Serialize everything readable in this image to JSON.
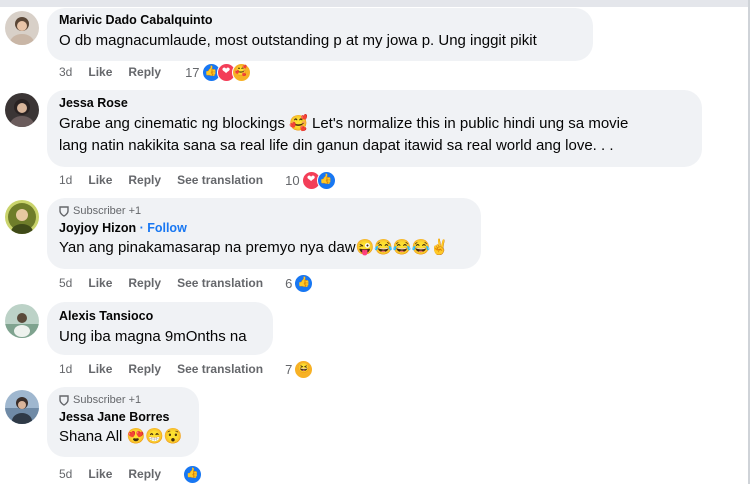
{
  "comments": [
    {
      "name": "Marivic Dado Cabalquinto",
      "text": "O db magnacumlaude, most outstanding p at my jowa p. Ung inggit pikit",
      "age": "3d",
      "like": "Like",
      "reply": "Reply",
      "reaction_count": "17",
      "reactions": [
        "like-icon",
        "love-icon",
        "care-icon"
      ]
    },
    {
      "name": "Jessa Rose",
      "text_line1": "Grabe ang cinematic ng blockings 🥰 Let's normalize this in public hindi ung sa movie",
      "text_line2": "lang natin nakikita sana sa real life din ganun dapat itawid sa real world ang love. . .",
      "age": "1d",
      "like": "Like",
      "reply": "Reply",
      "see_translation": "See translation",
      "reaction_count": "10",
      "reactions": [
        "love-icon",
        "like-icon"
      ]
    },
    {
      "badge": "Subscriber +1",
      "name": "Joyjoy Hizon",
      "follow": "· Follow",
      "text": "Yan ang pinakamasarap na premyo nya daw😜😂😂😂✌️",
      "age": "5d",
      "like": "Like",
      "reply": "Reply",
      "see_translation": "See translation",
      "reaction_count": "6",
      "reactions": [
        "like-icon"
      ]
    },
    {
      "name": "Alexis Tansioco",
      "text": "Ung iba magna 9mOnths na",
      "age": "1d",
      "like": "Like",
      "reply": "Reply",
      "see_translation": "See translation",
      "reaction_count": "7",
      "reactions": [
        "haha-icon"
      ]
    },
    {
      "badge": "Subscriber +1",
      "name": "Jessa Jane Borres",
      "text": "Shana All 😍😁😯",
      "age": "5d",
      "like": "Like",
      "reply": "Reply",
      "reactions": [
        "like-icon"
      ]
    }
  ],
  "colors": {
    "bubble": "#f0f2f5",
    "secondary_text": "#65676b",
    "like_blue": "#1877f2",
    "love_red": "#f33e58",
    "care_yellow": "#f7b125"
  }
}
